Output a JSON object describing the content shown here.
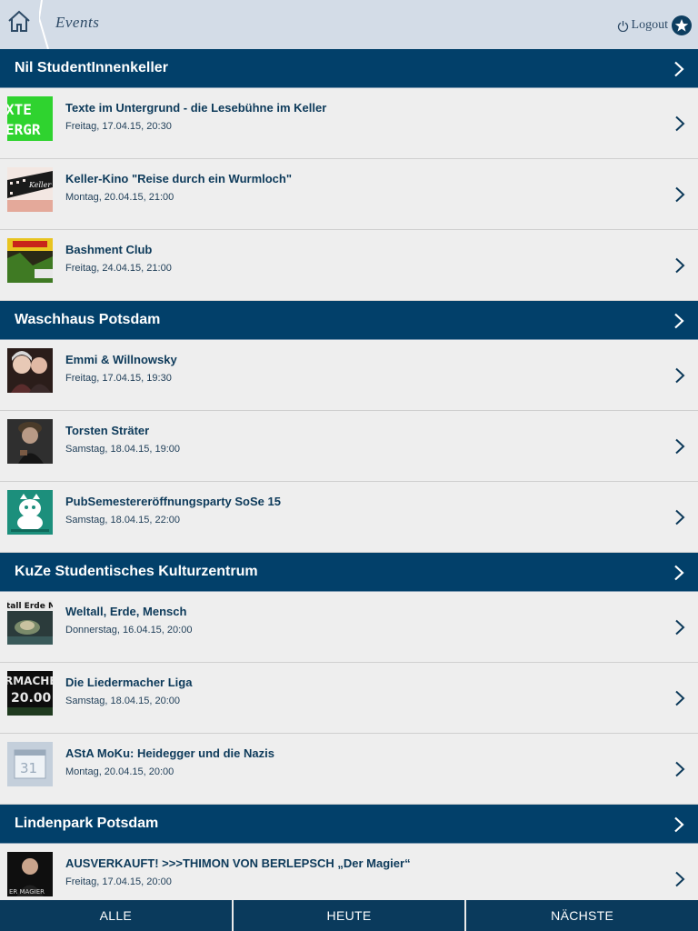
{
  "header": {
    "title": "Events",
    "logout_label": "Logout",
    "home_icon": "home-icon",
    "power_icon": "power-icon",
    "favorites_icon": "star-icon"
  },
  "colors": {
    "header_bg": "#d3dce7",
    "venue_bg": "#02406a",
    "tabbar_bg": "#0a3a5c",
    "text_dark": "#0d3a5a"
  },
  "venues": [
    {
      "name": "Nil StudentInnenkeller",
      "events": [
        {
          "title": "Texte im Untergrund - die Lesebühne im Keller",
          "date": "Freitag, 17.04.15, 20:30",
          "thumb_text": "XTE\nERGR"
        },
        {
          "title": "Keller-Kino \"Reise durch ein Wurmloch\"",
          "date": "Montag, 20.04.15, 21:00",
          "thumb_text": "Keller"
        },
        {
          "title": "Bashment Club",
          "date": "Freitag, 24.04.15, 21:00",
          "thumb_text": ""
        }
      ]
    },
    {
      "name": "Waschhaus Potsdam",
      "events": [
        {
          "title": "Emmi & Willnowsky",
          "date": "Freitag, 17.04.15, 19:30",
          "thumb_text": ""
        },
        {
          "title": "Torsten Sträter",
          "date": "Samstag, 18.04.15, 19:00",
          "thumb_text": ""
        },
        {
          "title": "PubSemestereröffnungsparty SoSe 15",
          "date": "Samstag, 18.04.15, 22:00",
          "thumb_text": ""
        }
      ]
    },
    {
      "name": "KuZe Studentisches Kulturzentrum",
      "events": [
        {
          "title": "Weltall, Erde, Mensch",
          "date": "Donnerstag, 16.04.15, 20:00",
          "thumb_text": "tall Erde Me"
        },
        {
          "title": "Die Liedermacher Liga",
          "date": "Samstag, 18.04.15, 20:00",
          "thumb_text": "RMACHER\n20.00"
        },
        {
          "title": "AStA MoKu: Heidegger und die Nazis",
          "date": "Montag, 20.04.15, 20:00",
          "thumb_text": "31"
        }
      ]
    },
    {
      "name": "Lindenpark Potsdam",
      "events": [
        {
          "title": "AUSVERKAUFT! >>>THIMON VON BERLEPSCH „Der Magier“",
          "date": "Freitag, 17.04.15, 20:00",
          "thumb_text": "ER MAGIER"
        }
      ]
    }
  ],
  "tabs": [
    "ALLE",
    "HEUTE",
    "NÄCHSTE"
  ]
}
